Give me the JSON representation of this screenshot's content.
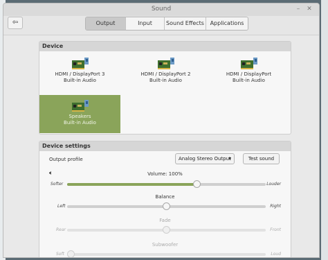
{
  "window": {
    "title": "Sound",
    "minimize": "–",
    "close": "✕"
  },
  "toolbar": {
    "back_icon": "back-arrow-icon",
    "back_glyph": "⇦",
    "tabs": [
      {
        "label": "Output",
        "active": true
      },
      {
        "label": "Input",
        "active": false
      },
      {
        "label": "Sound Effects",
        "active": false
      },
      {
        "label": "Applications",
        "active": false
      }
    ]
  },
  "device_section": {
    "title": "Device",
    "devices": [
      {
        "line1": "HDMI / DisplayPort 3",
        "line2": "Built-in Audio",
        "selected": false
      },
      {
        "line1": "HDMI / DisplayPort 2",
        "line2": "Built-in Audio",
        "selected": false
      },
      {
        "line1": "HDMI / DisplayPort",
        "line2": "Built-in Audio",
        "selected": false
      },
      {
        "line1": "Speakers",
        "line2": "Built-in Audio",
        "selected": true
      }
    ]
  },
  "settings_section": {
    "title": "Device settings",
    "output_profile_label": "Output profile",
    "output_profile_value": "Analog Stereo Output",
    "test_sound_label": "Test sound",
    "volume": {
      "label": "Volume: 100%",
      "min_label": "Softer",
      "max_label": "Louder",
      "value": 0.66
    },
    "balance": {
      "label": "Balance",
      "min_label": "Left",
      "max_label": "Right",
      "value": 0.5
    },
    "fade": {
      "label": "Fade",
      "min_label": "Rear",
      "max_label": "Front",
      "value": 0.5,
      "disabled": true
    },
    "subwoofer": {
      "label": "Subwoofer",
      "min_label": "Soft",
      "max_label": "Loud",
      "disabled": true
    }
  },
  "colors": {
    "accent": "#8aa45a"
  }
}
